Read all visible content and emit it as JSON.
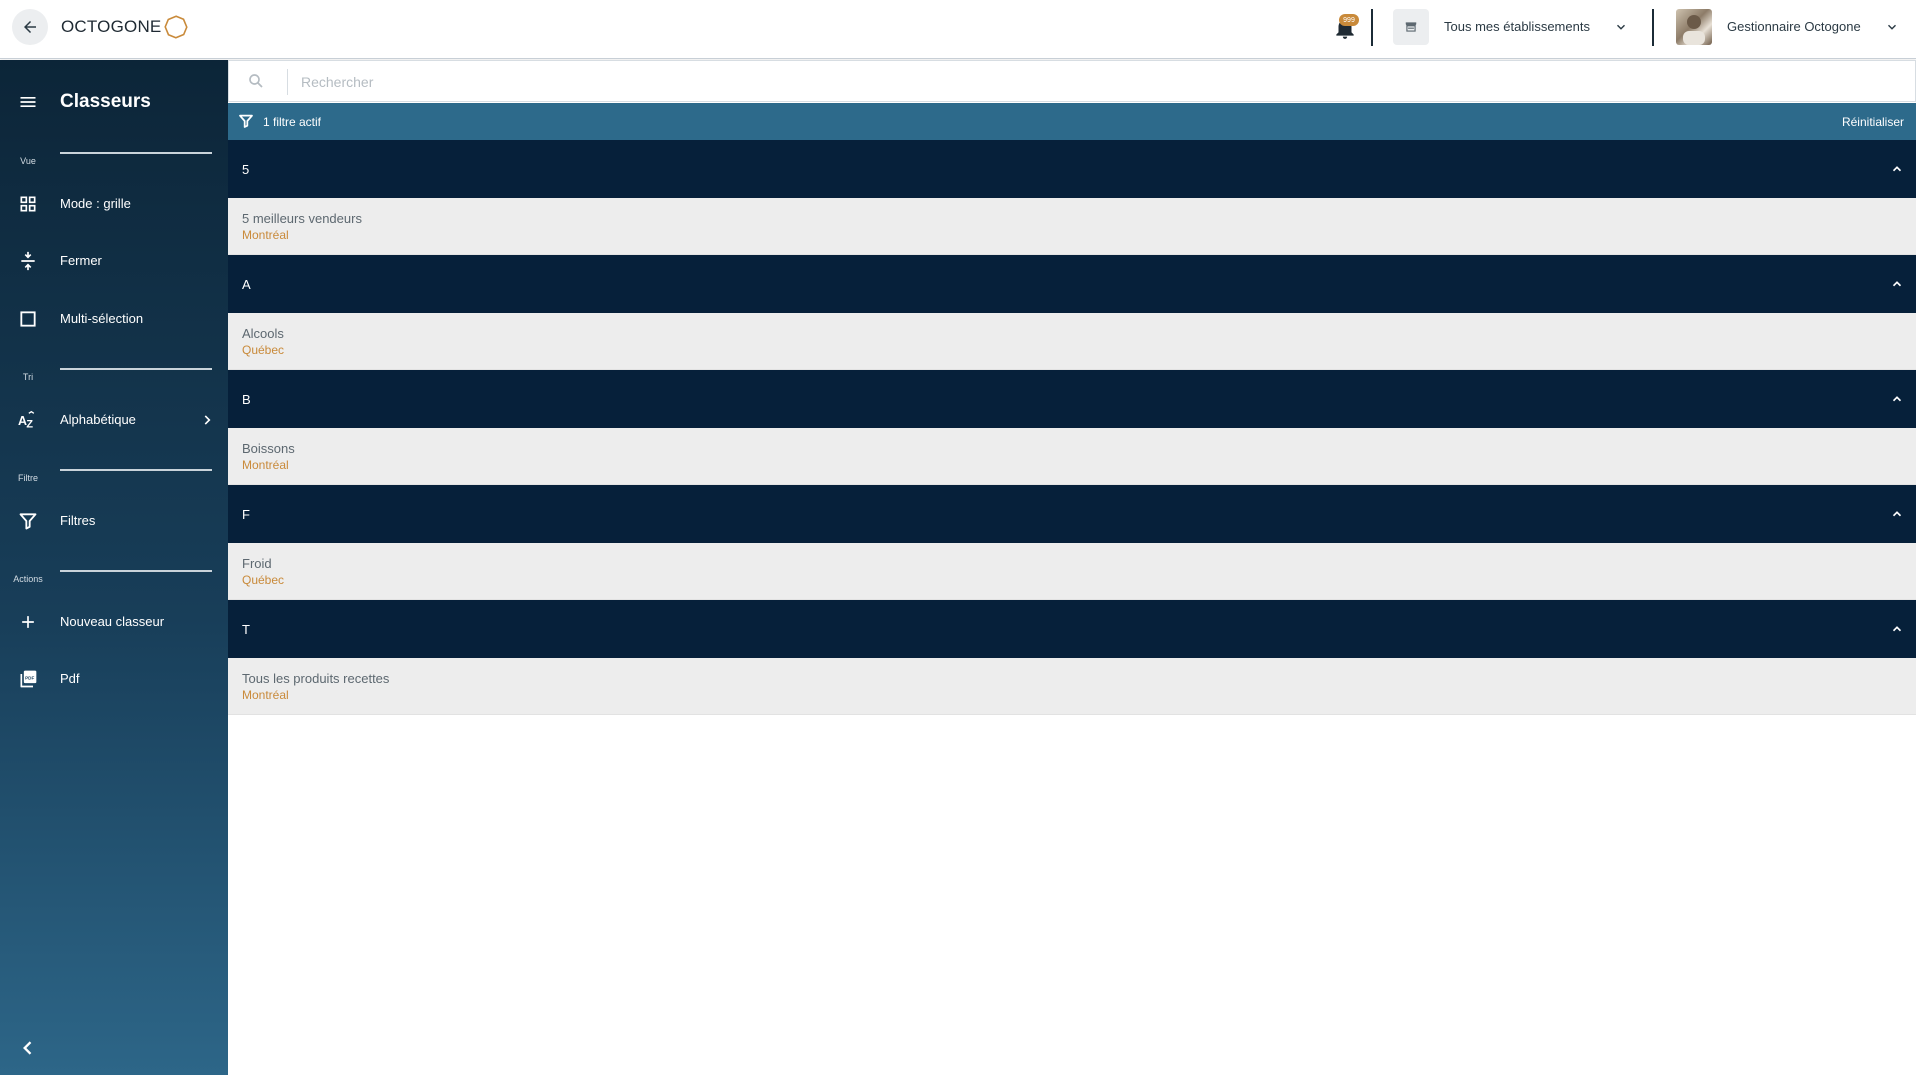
{
  "header": {
    "logo_text": "OCTOGONE",
    "notification_badge": "999",
    "establishments_label": "Tous mes établissements",
    "user_label": "Gestionnaire Octogone"
  },
  "sidebar": {
    "title": "Classeurs",
    "sections": {
      "vue": "Vue",
      "tri": "Tri",
      "filtre": "Filtre",
      "actions": "Actions"
    },
    "items": {
      "grid_mode": "Mode : grille",
      "close": "Fermer",
      "multi_select": "Multi-sélection",
      "alphabetical": "Alphabétique",
      "filters": "Filtres",
      "new_binder": "Nouveau classeur",
      "pdf": "Pdf"
    }
  },
  "search": {
    "placeholder": "Rechercher"
  },
  "filter_bar": {
    "active_label": "1 filtre actif",
    "reset_label": "Réinitialiser"
  },
  "groups": [
    {
      "letter": "5",
      "items": [
        {
          "name": "5 meilleurs vendeurs",
          "location": "Montréal"
        }
      ]
    },
    {
      "letter": "A",
      "items": [
        {
          "name": "Alcools",
          "location": "Québec"
        }
      ]
    },
    {
      "letter": "B",
      "items": [
        {
          "name": "Boissons",
          "location": "Montréal"
        }
      ]
    },
    {
      "letter": "F",
      "items": [
        {
          "name": "Froid",
          "location": "Québec"
        }
      ]
    },
    {
      "letter": "T",
      "items": [
        {
          "name": "Tous les produits recettes",
          "location": "Montréal"
        }
      ]
    }
  ],
  "colors": {
    "accent": "#c98a3a",
    "group_header": "#06203a",
    "filter_bar": "#2d6a8b",
    "item_bg": "#ededed"
  }
}
